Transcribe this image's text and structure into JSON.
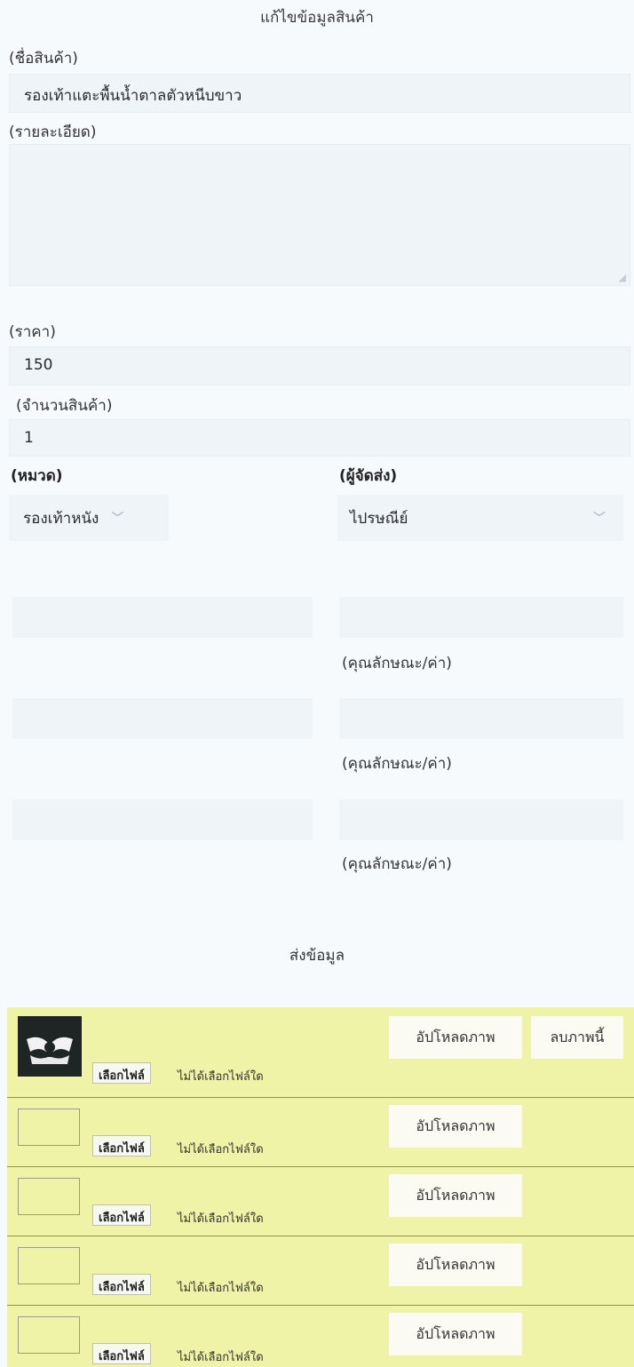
{
  "page_title": "แก้ไขข้อมูลสินค้า",
  "name": {
    "label": "(ชื่อสินค้า)",
    "value": "รองเท้าแตะพื้นน้ำตาลตัวหนีบขาว"
  },
  "details": {
    "label": "(รายละเอียด)",
    "value": ""
  },
  "price": {
    "label": "(ราคา)",
    "value": "150"
  },
  "quantity": {
    "label": "(จำนวนสินค้า)",
    "value": "1"
  },
  "category": {
    "label": "(หมวด)",
    "selected": "รองเท้าหนัง"
  },
  "shipper": {
    "label": "(ผู้จัดส่ง)",
    "selected": "ไปรษณีย์"
  },
  "attributes": [
    {
      "label": "(คุณลักษณะ/ค่า)"
    },
    {
      "label": "(คุณลักษณะ/ค่า)"
    },
    {
      "label": "(คุณลักษณะ/ค่า)"
    }
  ],
  "submit_label": "ส่งข้อมูล",
  "images": [
    {
      "choose_label": "เลือกไฟล์",
      "status": "ไม่ได้เลือกไฟล์ใด",
      "upload_label": "อัปโหลดภาพ",
      "delete_label": "ลบภาพนี้"
    },
    {
      "choose_label": "เลือกไฟล์",
      "status": "ไม่ได้เลือกไฟล์ใด",
      "upload_label": "อัปโหลดภาพ"
    },
    {
      "choose_label": "เลือกไฟล์",
      "status": "ไม่ได้เลือกไฟล์ใด",
      "upload_label": "อัปโหลดภาพ"
    },
    {
      "choose_label": "เลือกไฟล์",
      "status": "ไม่ได้เลือกไฟล์ใด",
      "upload_label": "อัปโหลดภาพ"
    },
    {
      "choose_label": "เลือกไฟล์",
      "status": "ไม่ได้เลือกไฟล์ใด",
      "upload_label": "อัปโหลดภาพ"
    }
  ],
  "icons": {
    "chevron": "chevron-down-icon",
    "resize": "resize-handle-icon",
    "thumbnail": "product-thumbnail"
  },
  "colors": {
    "background": "#f7fafd",
    "field": "#eef4f8",
    "image_panel": "#eef3a8"
  }
}
